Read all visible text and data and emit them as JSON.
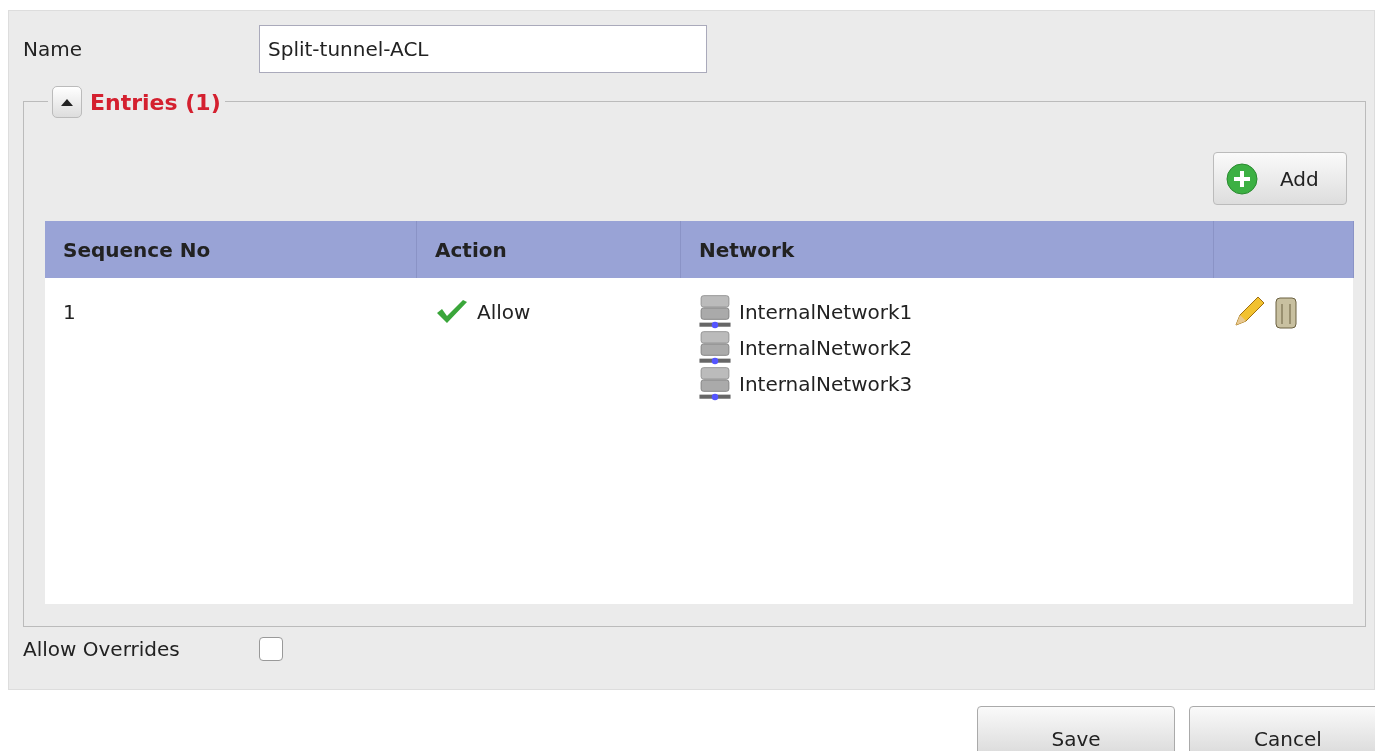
{
  "name_field": {
    "label": "Name",
    "value": "Split-tunnel-ACL"
  },
  "entries": {
    "title": "Entries (1)",
    "expanded": true,
    "add_button": "Add",
    "columns": [
      "Sequence No",
      "Action",
      "Network"
    ],
    "rows": [
      {
        "sequence": "1",
        "action": "Allow",
        "networks": [
          "InternalNetwork1",
          "InternalNetwork2",
          "InternalNetwork3"
        ]
      }
    ]
  },
  "allow_overrides": {
    "label": "Allow Overrides",
    "checked": false
  },
  "buttons": [
    "Save",
    "Cancel"
  ]
}
